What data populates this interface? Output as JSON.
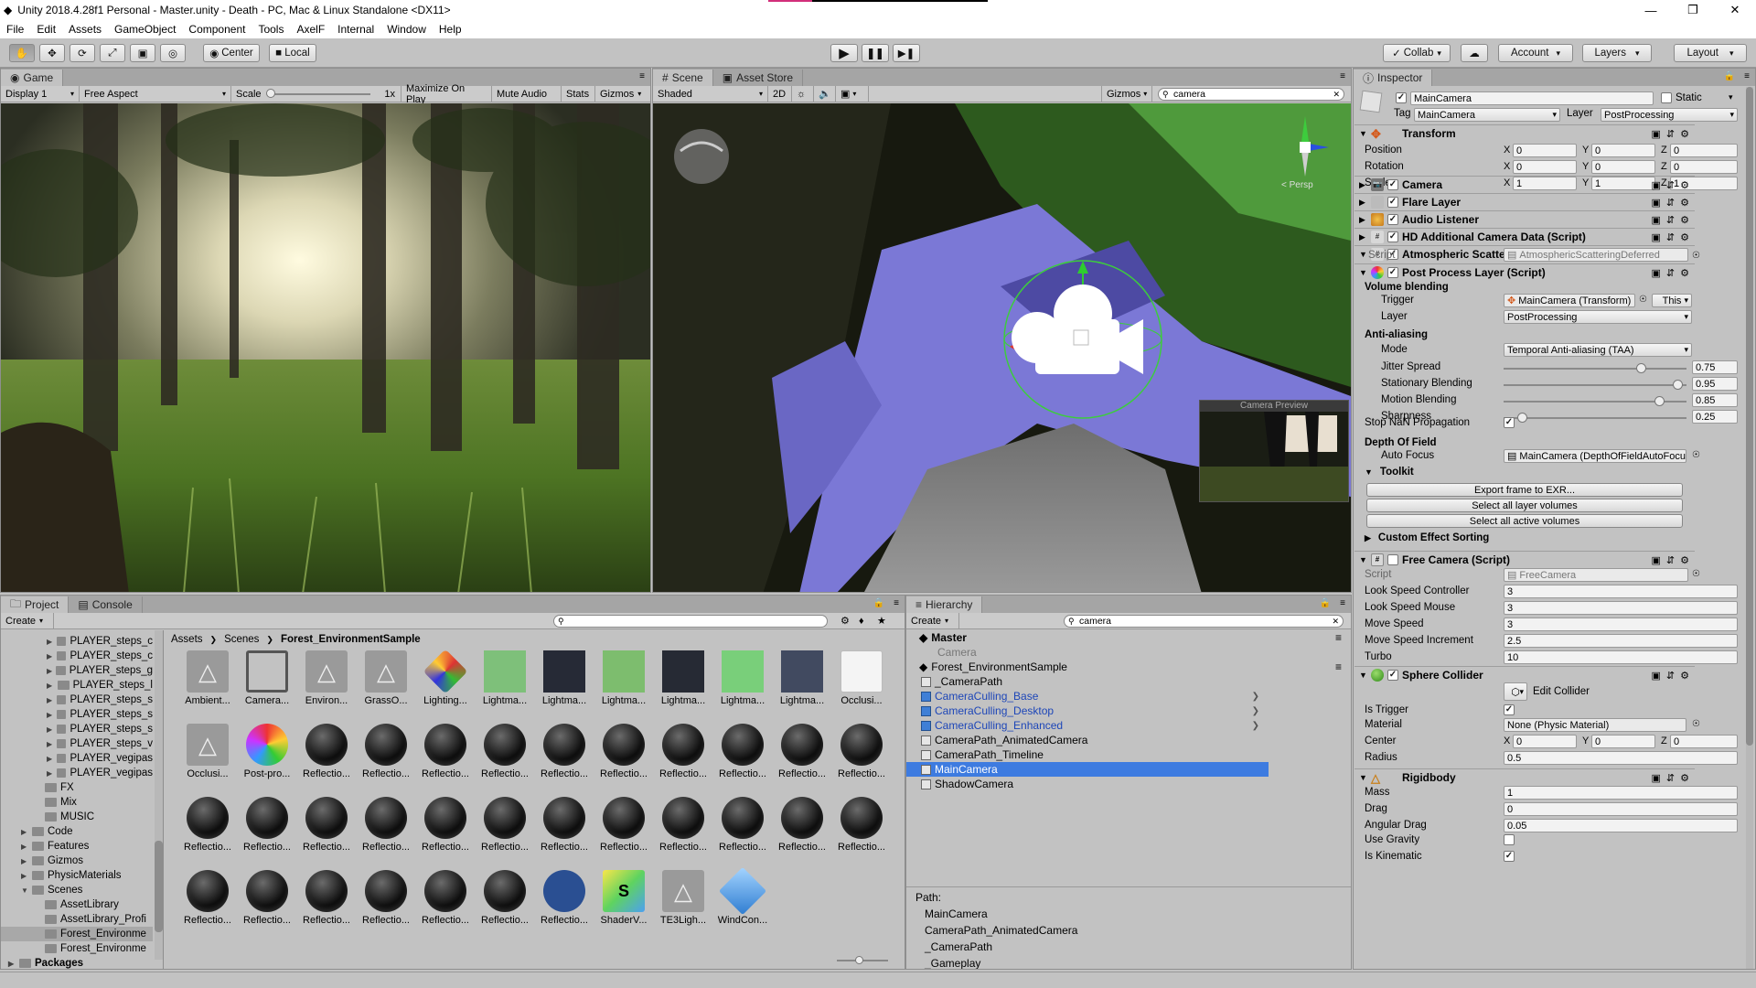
{
  "window": {
    "title": "Unity 2018.4.28f1 Personal - Master.unity - Death - PC, Mac & Linux Standalone <DX11>"
  },
  "menu": [
    "File",
    "Edit",
    "Assets",
    "GameObject",
    "Component",
    "Tools",
    "AxelF",
    "Internal",
    "Window",
    "Help"
  ],
  "toolbar": {
    "center_label": "Center",
    "local_label": "Local",
    "collab_label": "Collab",
    "account_label": "Account",
    "layers_label": "Layers",
    "layout_label": "Layout"
  },
  "game": {
    "tab": "Game",
    "display": "Display 1",
    "aspect": "Free Aspect",
    "scale_label": "Scale",
    "scale_value": "1x",
    "maximize": "Maximize On Play",
    "mute": "Mute Audio",
    "stats": "Stats",
    "gizmos": "Gizmos"
  },
  "scene": {
    "tab": "Scene",
    "tab2": "Asset Store",
    "shading": "Shaded",
    "mode2d": "2D",
    "gizmos": "Gizmos",
    "search": "camera",
    "persp": "< Persp",
    "preview_title": "Camera Preview"
  },
  "inspector": {
    "tab": "Inspector",
    "name": "MainCamera",
    "static_label": "Static",
    "tag_label": "Tag",
    "tag": "MainCamera",
    "layer_label": "Layer",
    "layer": "PostProcessing",
    "transform": {
      "title": "Transform",
      "rows": [
        {
          "label": "Position",
          "x": "0",
          "y": "0",
          "z": "0"
        },
        {
          "label": "Rotation",
          "x": "0",
          "y": "0",
          "z": "0"
        },
        {
          "label": "Scale",
          "x": "1",
          "y": "1",
          "z": "1"
        }
      ]
    },
    "components": [
      "Camera",
      "Flare Layer",
      "Audio Listener",
      "HD Additional Camera Data (Script)",
      "Atmospheric Scattering Deferred (Script)"
    ],
    "atmo_script_label": "Script",
    "atmo_script": "AtmosphericScatteringDeferred",
    "ppl": {
      "title": "Post Process Layer (Script)",
      "volume_blending": "Volume blending",
      "trigger_label": "Trigger",
      "trigger": "MainCamera (Transform)",
      "this_btn": "This",
      "layer_label": "Layer",
      "layer": "PostProcessing",
      "aa_title": "Anti-aliasing",
      "mode_label": "Mode",
      "mode": "Temporal Anti-aliasing (TAA)",
      "sliders": [
        {
          "label": "Jitter Spread",
          "value": "0.75",
          "frac": 0.75
        },
        {
          "label": "Stationary Blending",
          "value": "0.95",
          "frac": 0.95
        },
        {
          "label": "Motion Blending",
          "value": "0.85",
          "frac": 0.85
        },
        {
          "label": "Sharpness",
          "value": "0.25",
          "frac": 0.1
        }
      ],
      "stop_nan": "Stop NaN Propagation",
      "dof_title": "Depth Of Field",
      "autofocus_label": "Auto Focus",
      "autofocus": "MainCamera (DepthOfFieldAutoFocus)",
      "toolkit": "Toolkit",
      "btn_export": "Export frame to EXR...",
      "btn_layers": "Select all layer volumes",
      "btn_active": "Select all active volumes",
      "custom": "Custom Effect Sorting"
    },
    "freecam": {
      "title": "Free Camera (Script)",
      "script_label": "Script",
      "script": "FreeCamera",
      "rows": [
        {
          "label": "Look Speed Controller",
          "value": "3"
        },
        {
          "label": "Look Speed Mouse",
          "value": "3"
        },
        {
          "label": "Move Speed",
          "value": "3"
        },
        {
          "label": "Move Speed Increment",
          "value": "2.5"
        },
        {
          "label": "Turbo",
          "value": "10"
        }
      ]
    },
    "sphere": {
      "title": "Sphere Collider",
      "edit": "Edit Collider",
      "trigger_label": "Is Trigger",
      "material_label": "Material",
      "material": "None (Physic Material)",
      "center_label": "Center",
      "cx": "0",
      "cy": "0",
      "cz": "0",
      "radius_label": "Radius",
      "radius": "0.5"
    },
    "rigidbody": {
      "title": "Rigidbody",
      "rows": [
        {
          "label": "Mass",
          "value": "1"
        },
        {
          "label": "Drag",
          "value": "0"
        },
        {
          "label": "Angular Drag",
          "value": "0.05"
        }
      ],
      "gravity": "Use Gravity",
      "kinematic": "Is Kinematic"
    }
  },
  "project": {
    "tab": "Project",
    "tab2": "Console",
    "create": "Create",
    "breadcrumb": [
      "Assets",
      "Scenes",
      "Forest_EnvironmentSample"
    ],
    "tree": [
      {
        "label": "PLAYER_steps_c",
        "indent": 3
      },
      {
        "label": "PLAYER_steps_c",
        "indent": 3
      },
      {
        "label": "PLAYER_steps_g",
        "indent": 3
      },
      {
        "label": "PLAYER_steps_l",
        "indent": 3
      },
      {
        "label": "PLAYER_steps_s",
        "indent": 3
      },
      {
        "label": "PLAYER_steps_s",
        "indent": 3
      },
      {
        "label": "PLAYER_steps_s",
        "indent": 3
      },
      {
        "label": "PLAYER_steps_v",
        "indent": 3
      },
      {
        "label": "PLAYER_vegipas",
        "indent": 3
      },
      {
        "label": "PLAYER_vegipas",
        "indent": 3
      },
      {
        "label": "FX",
        "indent": 2
      },
      {
        "label": "Mix",
        "indent": 2
      },
      {
        "label": "MUSIC",
        "indent": 2
      },
      {
        "label": "Code",
        "indent": 1
      },
      {
        "label": "Features",
        "indent": 1
      },
      {
        "label": "Gizmos",
        "indent": 1
      },
      {
        "label": "PhysicMaterials",
        "indent": 1
      },
      {
        "label": "Scenes",
        "indent": 1
      },
      {
        "label": "AssetLibrary",
        "indent": 2
      },
      {
        "label": "AssetLibrary_Profi",
        "indent": 2
      },
      {
        "label": "Forest_Environme",
        "indent": 2
      },
      {
        "label": "Forest_Environme",
        "indent": 2
      },
      {
        "label": "Packages",
        "indent": 0
      }
    ],
    "assets": [
      {
        "label": "Ambient...",
        "kind": "unity"
      },
      {
        "label": "Camera...",
        "kind": "film"
      },
      {
        "label": "Environ...",
        "kind": "unity"
      },
      {
        "label": "GrassO...",
        "kind": "unity"
      },
      {
        "label": "Lighting...",
        "kind": "lighting"
      },
      {
        "label": "Lightma...",
        "kind": "lm1"
      },
      {
        "label": "Lightma...",
        "kind": "lm2"
      },
      {
        "label": "Lightma...",
        "kind": "lm3"
      },
      {
        "label": "Lightma...",
        "kind": "lm4"
      },
      {
        "label": "Lightma...",
        "kind": "lm5"
      },
      {
        "label": "Lightma...",
        "kind": "lm6"
      },
      {
        "label": "Occlusi...",
        "kind": "doc"
      },
      {
        "label": "Occlusi...",
        "kind": "unity"
      },
      {
        "label": "Post-pro...",
        "kind": "post"
      },
      {
        "label": "Reflectio...",
        "kind": "sphere"
      },
      {
        "label": "Reflectio...",
        "kind": "sphere"
      },
      {
        "label": "Reflectio...",
        "kind": "sphere"
      },
      {
        "label": "Reflectio...",
        "kind": "sphere"
      },
      {
        "label": "Reflectio...",
        "kind": "sphere"
      },
      {
        "label": "Reflectio...",
        "kind": "sphere"
      },
      {
        "label": "Reflectio...",
        "kind": "sphere"
      },
      {
        "label": "Reflectio...",
        "kind": "sphere"
      },
      {
        "label": "Reflectio...",
        "kind": "sphere"
      },
      {
        "label": "Reflectio...",
        "kind": "sphere"
      },
      {
        "label": "Reflectio...",
        "kind": "sphere"
      },
      {
        "label": "Reflectio...",
        "kind": "sphere"
      },
      {
        "label": "Reflectio...",
        "kind": "sphere"
      },
      {
        "label": "Reflectio...",
        "kind": "sphere"
      },
      {
        "label": "Reflectio...",
        "kind": "sphere"
      },
      {
        "label": "Reflectio...",
        "kind": "sphere"
      },
      {
        "label": "Reflectio...",
        "kind": "sphere"
      },
      {
        "label": "Reflectio...",
        "kind": "sphere"
      },
      {
        "label": "Reflectio...",
        "kind": "sphere"
      },
      {
        "label": "Reflectio...",
        "kind": "sphere"
      },
      {
        "label": "Reflectio...",
        "kind": "sphere"
      },
      {
        "label": "Reflectio...",
        "kind": "sphere"
      },
      {
        "label": "Reflectio...",
        "kind": "sphere"
      },
      {
        "label": "Reflectio...",
        "kind": "sphere"
      },
      {
        "label": "Reflectio...",
        "kind": "sphere"
      },
      {
        "label": "Reflectio...",
        "kind": "sphere"
      },
      {
        "label": "Reflectio...",
        "kind": "sphere"
      },
      {
        "label": "Reflectio...",
        "kind": "sphere"
      },
      {
        "label": "Reflectio...",
        "kind": "blue"
      },
      {
        "label": "ShaderV...",
        "kind": "shader"
      },
      {
        "label": "TE3Ligh...",
        "kind": "unity"
      },
      {
        "label": "WindCon...",
        "kind": "cube"
      }
    ]
  },
  "hierarchy": {
    "tab": "Hierarchy",
    "create": "Create",
    "search": "camera",
    "scene1": "Master",
    "scene1_child": "Camera",
    "scene2": "Forest_EnvironmentSample",
    "items": [
      {
        "label": "_CameraPath",
        "style": "normal"
      },
      {
        "label": "CameraCulling_Base",
        "style": "blue"
      },
      {
        "label": "CameraCulling_Desktop",
        "style": "blue"
      },
      {
        "label": "CameraCulling_Enhanced",
        "style": "blue"
      },
      {
        "label": "CameraPath_AnimatedCamera",
        "style": "normal"
      },
      {
        "label": "CameraPath_Timeline",
        "style": "normal"
      },
      {
        "label": "MainCamera",
        "style": "sel"
      },
      {
        "label": "ShadowCamera",
        "style": "normal"
      }
    ],
    "path_label": "Path:",
    "path": [
      "MainCamera",
      "CameraPath_AnimatedCamera",
      "_CameraPath",
      "_Gameplay"
    ]
  }
}
